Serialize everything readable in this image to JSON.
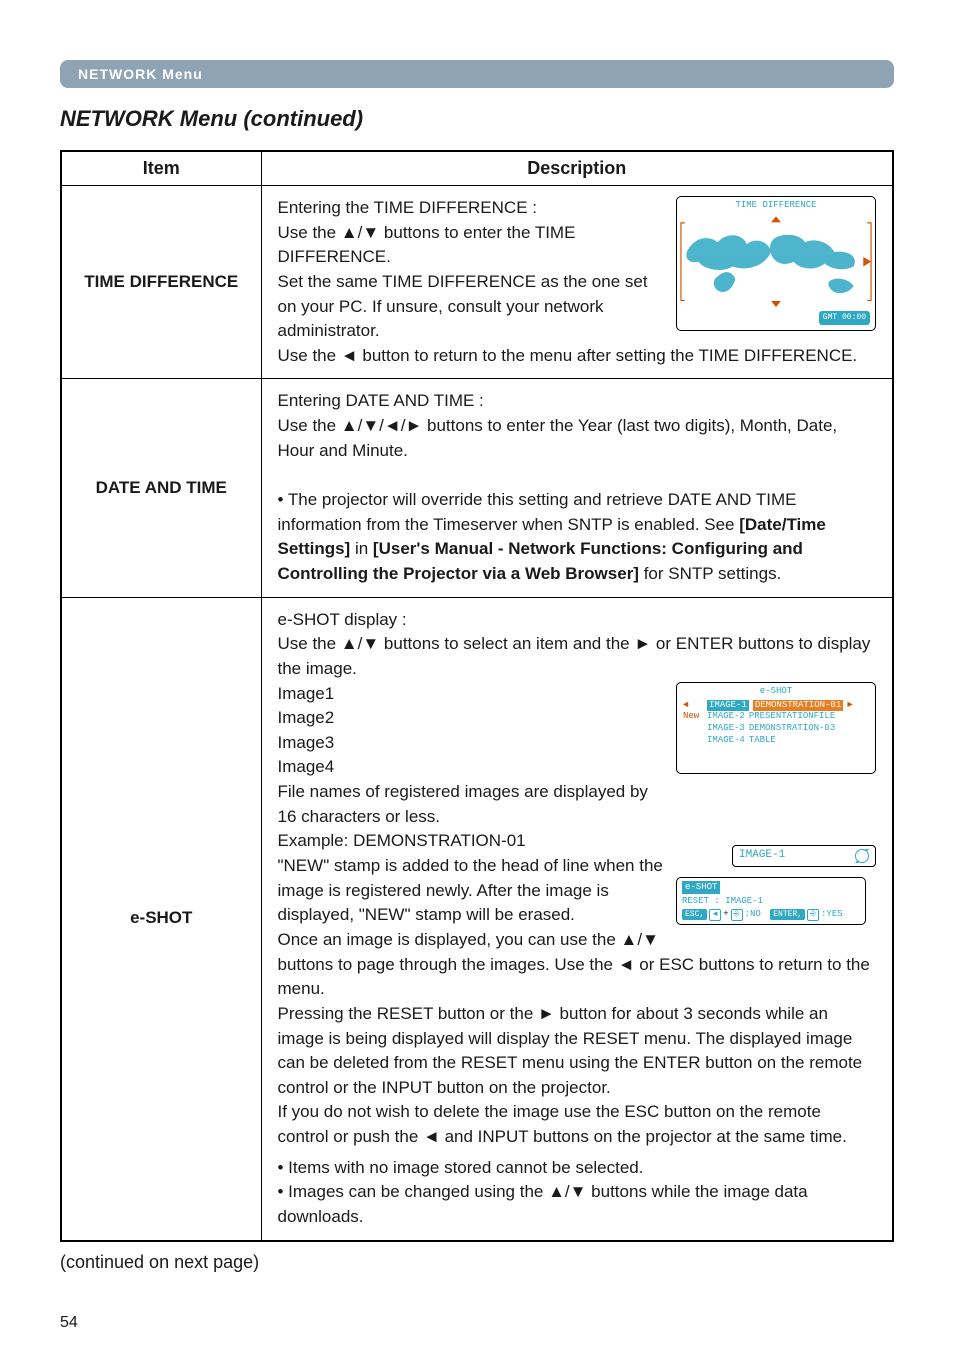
{
  "header": {
    "menu_label": "NETWORK Menu",
    "section_title": "NETWORK Menu (continued)"
  },
  "table": {
    "headers": {
      "item": "Item",
      "description": "Description"
    },
    "rows": [
      {
        "item": "TIME DIFFERENCE",
        "desc_plain": "Entering the TIME DIFFERENCE :\nUse the ▲/▼ buttons to enter the TIME DIFFERENCE.\nSet the same TIME DIFFERENCE as the one set on your PC. If unsure, consult your network administrator.\nUse the ◄ button to return to the menu after setting the TIME DIFFERENCE.",
        "figure": {
          "title": "TIME DIFFERENCE",
          "gmt": "GMT 00:00"
        }
      },
      {
        "item": "DATE AND TIME",
        "desc_html": "Entering DATE AND TIME :<br>Use the ▲/▼/◄/► buttons to enter the Year (last two digits), Month, Date, Hour and Minute.<br><br>• The projector will override this setting and retrieve  DATE AND TIME information from the Timeserver when SNTP is enabled. See <b>[Date/Time Settings]</b> in <b>[User's Manual - Network Functions: Configuring and Controlling the Projector via a Web Browser]</b> for SNTP settings."
      },
      {
        "item": "e-SHOT",
        "intro": "e-SHOT display :\nUse the ▲/▼ buttons to select an item and the ► or ENTER buttons to display the image.",
        "images_list": [
          "Image1",
          "Image2",
          "Image3",
          "Image4"
        ],
        "eshot_panel_title": "e-SHOT",
        "eshot_rows": [
          {
            "tag": "",
            "label": "IMAGE-1",
            "file": "DEMONSTRATION-01",
            "hl": true,
            "arrow": "►"
          },
          {
            "tag": "New",
            "label": "IMAGE-2",
            "file": "PRESENTATIONFILE"
          },
          {
            "tag": "",
            "label": "IMAGE-3",
            "file": "DEMONSTRATION-03"
          },
          {
            "tag": "",
            "label": "IMAGE-4",
            "file": "TABLE"
          }
        ],
        "img1_box_label": "IMAGE-1",
        "reset_panel": {
          "title": "e-SHOT",
          "line1": "RESET : IMAGE-1",
          "esc": "ESC,",
          "no": ":NO",
          "enter": "ENTER,",
          "yes": ":YES"
        },
        "body_html": "File names of registered images are displayed by 16 characters or less.<br>Example: DEMONSTRATION-01<br>\"NEW\" stamp is added to the head of line when the image is registered newly. After the image is displayed, \"NEW\" stamp will be erased.<br>Once an image is displayed, you can use the ▲/▼ buttons to page through the images. Use the ◄ or ESC buttons to return to the menu.<br>Pressing the RESET button or the ► button for about 3 seconds while an image is being displayed will display the RESET menu. The displayed image can be deleted from the RESET menu using the ENTER button on the remote control or the INPUT button on the projector.<br>If you do not wish to delete the image use the ESC button on the remote control or push the ◄ and INPUT buttons on the projector at the same time.",
        "bullets": [
          "• Items with no image stored cannot be selected.",
          "• Images can be changed using the ▲/▼ buttons while the image data downloads."
        ]
      }
    ]
  },
  "footer": {
    "continued": "(continued on next page)",
    "page": "54"
  }
}
